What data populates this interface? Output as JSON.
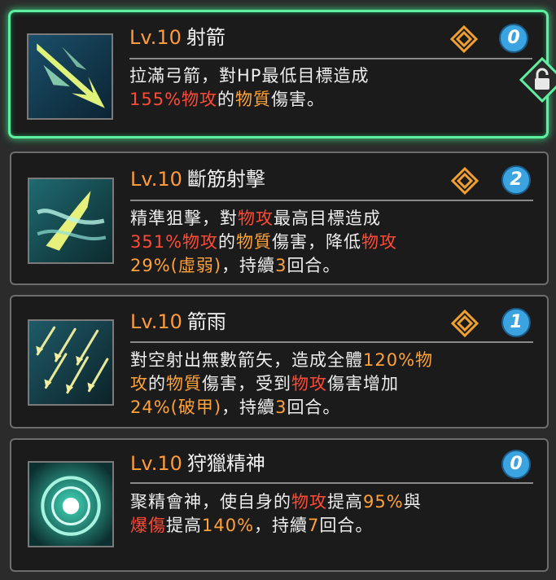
{
  "skills": [
    {
      "level": "Lv.10",
      "name": "射箭",
      "count": "0",
      "desc1": [
        {
          "text": "拉滿弓箭，對HP最低目標造成",
          "c": ""
        }
      ],
      "desc2": [
        {
          "text": "155%物攻",
          "c": "r"
        },
        {
          "text": "的",
          "c": ""
        },
        {
          "text": "物質",
          "c": "o"
        },
        {
          "text": "傷害。",
          "c": ""
        }
      ]
    },
    {
      "level": "Lv.10",
      "name": "斷筋射擊",
      "count": "2",
      "desc1": [
        {
          "text": "精準狙擊，對",
          "c": ""
        },
        {
          "text": "物攻",
          "c": "r"
        },
        {
          "text": "最高目標造成",
          "c": ""
        }
      ],
      "desc2": [
        {
          "text": "351%物攻",
          "c": "r"
        },
        {
          "text": "的",
          "c": ""
        },
        {
          "text": "物質",
          "c": "o"
        },
        {
          "text": "傷害，降低",
          "c": ""
        },
        {
          "text": "物攻",
          "c": "r"
        }
      ],
      "desc3": [
        {
          "text": "29%(虛弱)",
          "c": "o"
        },
        {
          "text": "，持續",
          "c": ""
        },
        {
          "text": "3",
          "c": "o"
        },
        {
          "text": "回合。",
          "c": ""
        }
      ]
    },
    {
      "level": "Lv.10",
      "name": "箭雨",
      "count": "1",
      "desc1": [
        {
          "text": "對空射出無數箭矢，造成全體",
          "c": ""
        },
        {
          "text": "120%物",
          "c": "o"
        }
      ],
      "desc2": [
        {
          "text": "攻",
          "c": "o"
        },
        {
          "text": "的",
          "c": ""
        },
        {
          "text": "物質",
          "c": "o"
        },
        {
          "text": "傷害，受到",
          "c": ""
        },
        {
          "text": "物攻",
          "c": "r"
        },
        {
          "text": "傷害增加",
          "c": ""
        }
      ],
      "desc3": [
        {
          "text": "24%(破甲)",
          "c": "o"
        },
        {
          "text": "，持續",
          "c": ""
        },
        {
          "text": "3",
          "c": "o"
        },
        {
          "text": "回合。",
          "c": ""
        }
      ]
    },
    {
      "level": "Lv.10",
      "name": "狩獵精神",
      "count": "0",
      "desc1": [
        {
          "text": "聚精會神，使自身的",
          "c": ""
        },
        {
          "text": "物攻",
          "c": "r"
        },
        {
          "text": "提高",
          "c": ""
        },
        {
          "text": "95%",
          "c": "o"
        },
        {
          "text": "與",
          "c": ""
        }
      ],
      "desc2": [
        {
          "text": "爆傷",
          "c": "r"
        },
        {
          "text": "提高",
          "c": ""
        },
        {
          "text": "140%",
          "c": "o"
        },
        {
          "text": "，持續",
          "c": ""
        },
        {
          "text": "7",
          "c": "o"
        },
        {
          "text": "回合。",
          "c": ""
        }
      ]
    }
  ],
  "icons": {
    "skill1": "arrow-shot-icon",
    "skill2": "tendon-shot-icon",
    "skill3": "arrow-rain-icon",
    "skill4": "hunting-spirit-icon",
    "rune": "diamond-rune-icon",
    "lock": "padlock-icon"
  },
  "colors": {
    "level": "#ff9b3c",
    "keyword_orange": "#ffa23a",
    "keyword_red": "#ff4a36",
    "selected_border": "#5ef0a0",
    "badge": "#3ba3e0"
  }
}
